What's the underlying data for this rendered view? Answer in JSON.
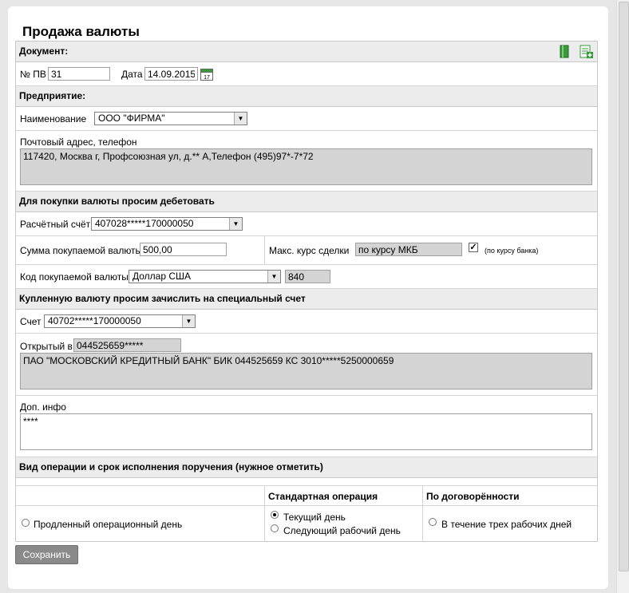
{
  "page": {
    "title": "Продажа валюты"
  },
  "document": {
    "section_label": "Документ:",
    "pv_label": "№ ПВ",
    "pv_value": "31",
    "date_label": "Дата",
    "date_value": "14.09.2015",
    "calendar_day": "17"
  },
  "enterprise": {
    "section_label": "Предприятие:",
    "name_label": "Наименование",
    "name_value": "ООО \"ФИРМА\"",
    "address_label": "Почтовый адрес, телефон",
    "address_value": "117420, Москва г, Профсоюзная ул, д.** А,Телефон (495)97*-7*72"
  },
  "debit": {
    "section_label": "Для покупки валюты просим дебетовать",
    "account_label": "Расчётный счёт",
    "account_value": "407028*****170000050",
    "amount_label": "Сумма покупаемой валюты",
    "amount_value": "500,00",
    "max_rate_label": "Макс. курс сделки",
    "max_rate_value": "по курсу МКБ",
    "bank_rate_checked": true,
    "bank_rate_label": "(по курсу банка)",
    "currency_code_label": "Код покупаемой валюты",
    "currency_value": "Доллар США",
    "currency_code": "840"
  },
  "credit": {
    "section_label": "Купленную валюту просим зачислить на специальный счет",
    "account_label": "Счет",
    "account_value": "40702*****170000050",
    "opened_label": "Открытый в",
    "opened_value": "044525659*****",
    "bank_details": "ПАО \"МОСКОВСКИЙ КРЕДИТНЫЙ БАНК\" БИК 044525659 КС 3010*****5250000659"
  },
  "extra": {
    "label": "Доп. инфо",
    "value": "****"
  },
  "operation": {
    "section_label": "Вид операции и срок исполнения поручения (нужное отметить)",
    "col_standard": "Стандартная операция",
    "col_agreement": "По договорённости",
    "extended_day_label": "Продленный операционный день",
    "current_day_label": "Текущий день",
    "next_day_label": "Следующий рабочий день",
    "three_days_label": "В течение трех рабочих дней",
    "selected": "current_day"
  },
  "actions": {
    "save_label": "Сохранить"
  },
  "colors": {
    "section_bg": "#ececec",
    "readonly_bg": "#d4d4d4",
    "button_bg": "#8a8a8a",
    "icon_green": "#3a9a3a"
  }
}
